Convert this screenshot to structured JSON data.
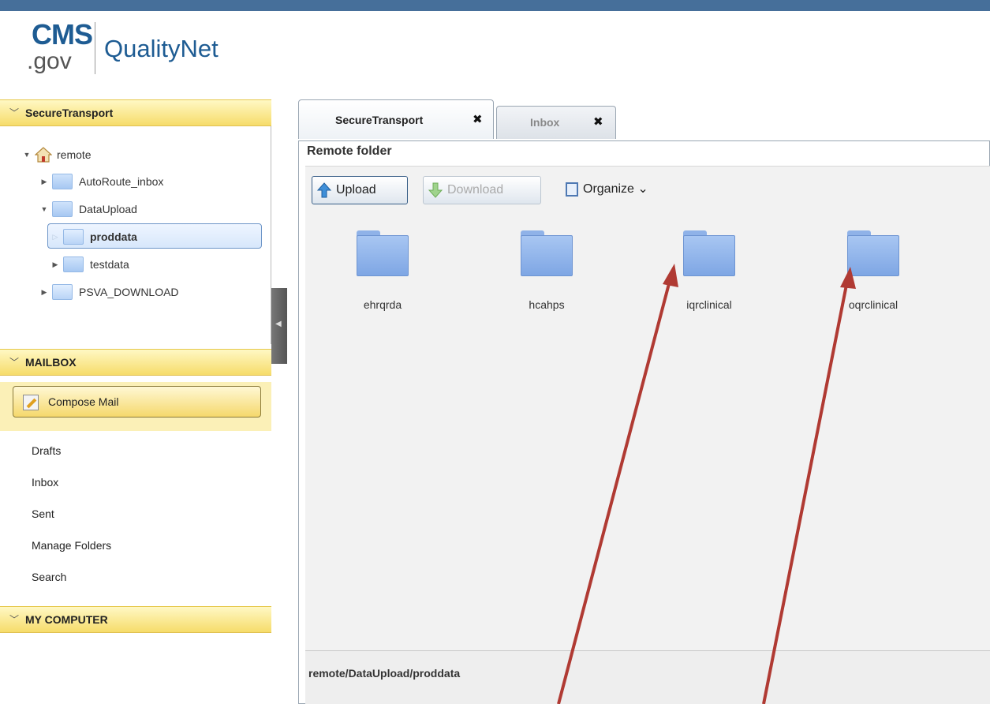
{
  "header": {
    "logo_cms": "CMS",
    "logo_gov": ".gov",
    "logo_brand": "QualityNet"
  },
  "sidebar": {
    "secure_transport": {
      "title": "SecureTransport",
      "tree": {
        "root": "remote",
        "items": [
          {
            "label": "AutoRoute_inbox"
          },
          {
            "label": "DataUpload"
          },
          {
            "label": "proddata"
          },
          {
            "label": "testdata"
          },
          {
            "label": "PSVA_DOWNLOAD"
          }
        ]
      }
    },
    "mailbox": {
      "title": "MAILBOX",
      "compose_label": "Compose Mail",
      "items": [
        {
          "label": "Drafts"
        },
        {
          "label": "Inbox"
        },
        {
          "label": "Sent"
        },
        {
          "label": "Manage Folders"
        },
        {
          "label": "Search"
        }
      ]
    },
    "my_computer": {
      "title": "MY COMPUTER"
    }
  },
  "tabs": [
    {
      "label": "SecureTransport",
      "close": "✖"
    },
    {
      "label": "Inbox",
      "close": "✖"
    }
  ],
  "main": {
    "title": "Remote folder",
    "toolbar": {
      "upload": "Upload",
      "download": "Download",
      "organize": "Organize"
    },
    "folders": [
      {
        "label": "ehrqrda"
      },
      {
        "label": "hcahps"
      },
      {
        "label": "iqrclinical"
      },
      {
        "label": "oqrclinical"
      }
    ],
    "path": "remote/DataUpload/proddata"
  },
  "colors": {
    "top_bar": "#466f9a",
    "panel_header": "#f6dc6a",
    "arrow": "#b03a33",
    "folder": "#7ea6e4"
  }
}
